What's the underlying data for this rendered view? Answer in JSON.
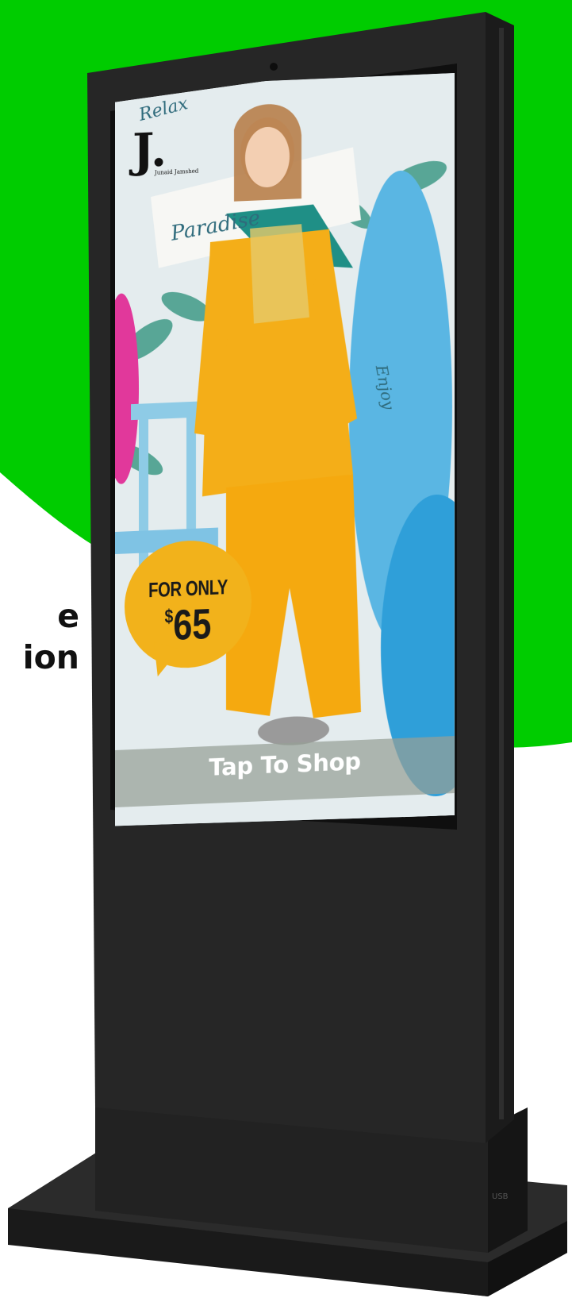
{
  "colors": {
    "background": "#ffffff",
    "accent_green": "#00cc00",
    "kiosk_body": "#262626",
    "badge_yellow": "#f2b21b"
  },
  "tagline": {
    "line1": "e",
    "line2": "ion"
  },
  "kiosk_screen": {
    "brand_logo": "J.",
    "brand_subtitle": "Junaid Jamshed",
    "scene_text_1": "Relax",
    "scene_text_2": "Paradise",
    "scene_text_3": "Enjoy",
    "price_badge": {
      "label": "FOR ONLY",
      "currency": "$",
      "amount": "65"
    },
    "cta_label": "Tap To Shop"
  },
  "icons": [
    "camera-lens-icon",
    "speech-bubble-icon"
  ]
}
